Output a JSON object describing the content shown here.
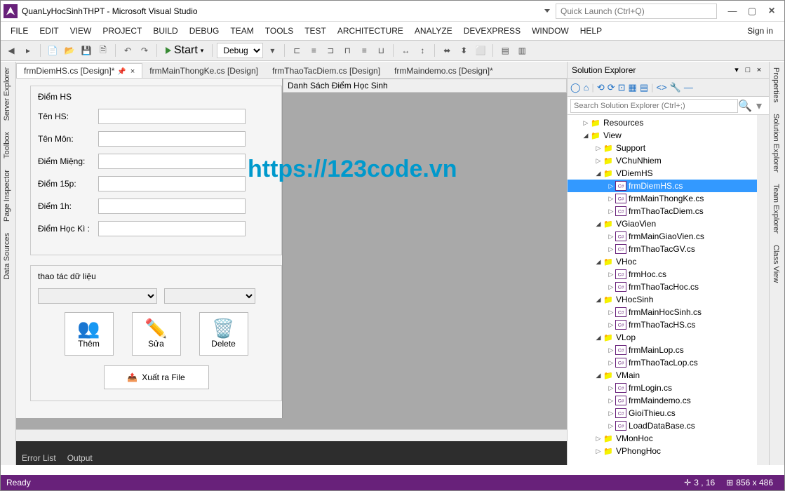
{
  "window": {
    "title": "QuanLyHocSinhTHPT - Microsoft Visual Studio",
    "quick_launch_placeholder": "Quick Launch (Ctrl+Q)"
  },
  "menu": {
    "file": "FILE",
    "edit": "EDIT",
    "view": "VIEW",
    "project": "PROJECT",
    "build": "BUILD",
    "debug": "DEBUG",
    "team": "TEAM",
    "tools": "TOOLS",
    "test": "TEST",
    "architecture": "ARCHITECTURE",
    "analyze": "ANALYZE",
    "devexpress": "DEVEXPRESS",
    "window": "WINDOW",
    "help": "HELP",
    "signin": "Sign in"
  },
  "toolbar": {
    "start": "Start",
    "config": "Debug"
  },
  "left_tabs": {
    "server_explorer": "Server Explorer",
    "toolbox": "Toolbox",
    "page_inspector": "Page Inspector",
    "data_sources": "Data Sources"
  },
  "right_tabs": {
    "properties": "Properties",
    "solution_explorer": "Solution Explorer",
    "team_explorer": "Team Explorer",
    "class_view": "Class View"
  },
  "doc_tabs": {
    "t0": "frmDiemHS.cs [Design]*",
    "t1": "frmMainThongKe.cs [Design]",
    "t2": "frmThaoTacDiem.cs [Design]",
    "t3": "frmMaindemo.cs [Design]*"
  },
  "form": {
    "group1": "Điểm HS",
    "ten_hs": "Tên HS:",
    "ten_mon": "Tên Môn:",
    "diem_mieng": "Điểm Miệng:",
    "diem_15p": "Điểm 15p:",
    "diem_1h": "Điểm 1h:",
    "diem_hk": "Điểm Học Kì :",
    "group2": "thao tác dữ liệu",
    "them": "Thêm",
    "sua": "Sửa",
    "delete": "Delete",
    "export": "Xuất ra File",
    "grid_title": "Danh Sách Điểm Học Sinh"
  },
  "solution": {
    "title": "Solution Explorer",
    "search_placeholder": "Search Solution Explorer (Ctrl+;)",
    "nodes": {
      "resources": "Resources",
      "view": "View",
      "support": "Support",
      "vchunhiem": "VChuNhiem",
      "vdiemhs": "VDiemHS",
      "frmdiemhs": "frmDiemHS.cs",
      "frmmainthongke": "frmMainThongKe.cs",
      "frmthaotacdiem": "frmThaoTacDiem.cs",
      "vgiaovien": "VGiaoVien",
      "frmmaingiaovien": "frmMainGiaoVien.cs",
      "frmthaotacgv": "frmThaoTacGV.cs",
      "vhoc": "VHoc",
      "frmhoc": "frmHoc.cs",
      "frmthaotachoc": "frmThaoTacHoc.cs",
      "vhocsinh": "VHocSinh",
      "frmmainhocsinh": "frmMainHocSinh.cs",
      "frmthaotachs": "frmThaoTacHS.cs",
      "vlop": "VLop",
      "frmmainlop": "frmMainLop.cs",
      "frmthaotaclop": "frmThaoTacLop.cs",
      "vmain": "VMain",
      "frmlogin": "frmLogin.cs",
      "frmmaindemo": "frmMaindemo.cs",
      "gioithieu": "GioiThieu.cs",
      "loaddatabase": "LoadDataBase.cs",
      "vmonhoc": "VMonHoc",
      "vphonghoc": "VPhongHoc"
    }
  },
  "bottom": {
    "error_list": "Error List",
    "output": "Output"
  },
  "status": {
    "ready": "Ready",
    "pos": "3 , 16",
    "size": "856 x 486"
  },
  "watermark": "https://123code.vn"
}
